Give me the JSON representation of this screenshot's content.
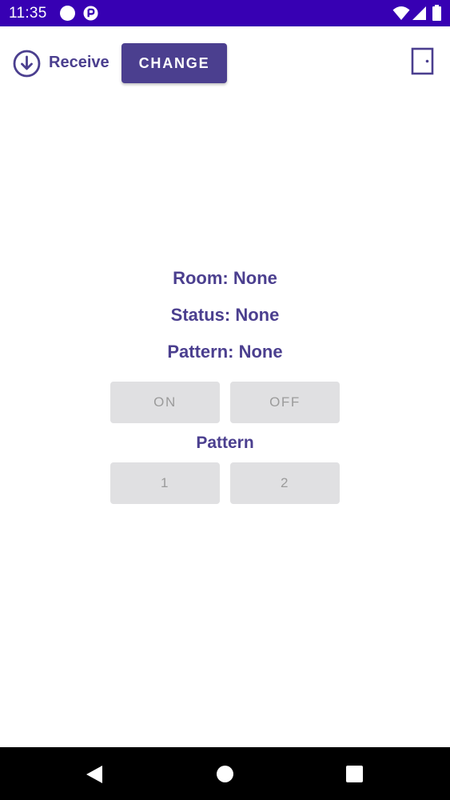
{
  "status_bar": {
    "time": "11:35",
    "background": "#3700b3",
    "icons": [
      "notification-dot-icon",
      "app-notification-icon",
      "wifi-icon",
      "signal-icon",
      "battery-icon"
    ]
  },
  "toolbar": {
    "receive_icon": "download-circle-icon",
    "receive_label": "Receive",
    "change_label": "CHANGE",
    "door_icon": "door-icon"
  },
  "info": {
    "room": "Room: None",
    "status": "Status: None",
    "pattern": "Pattern: None"
  },
  "controls": {
    "on_label": "ON",
    "off_label": "OFF",
    "pattern_heading": "Pattern",
    "pattern_1_label": "1",
    "pattern_2_label": "2"
  },
  "nav_bar": {
    "icons": [
      "back-icon",
      "home-icon",
      "recents-icon"
    ]
  },
  "colors": {
    "accent": "#4b3f8f",
    "disabled_button": "#e0e0e2",
    "disabled_text": "#9b9b9b"
  }
}
